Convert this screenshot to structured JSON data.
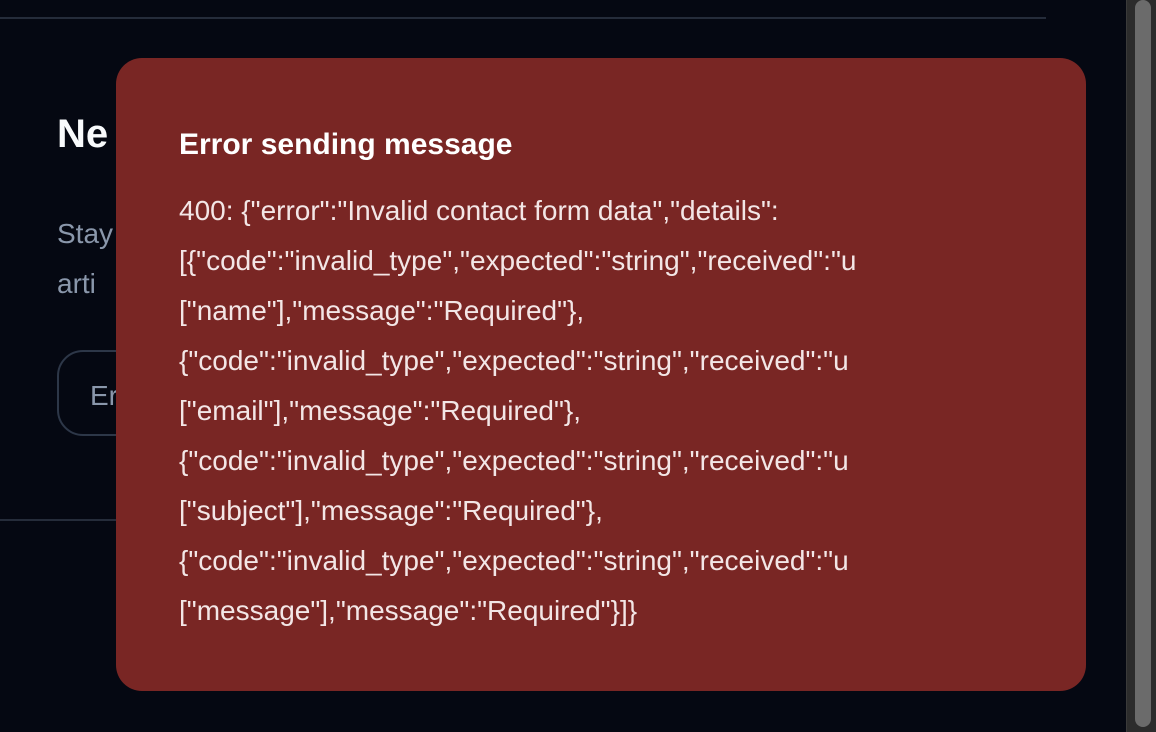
{
  "background": {
    "heading": "Ne",
    "subtitle_lines": [
      "Stay",
      "arti"
    ],
    "input_placeholder": "Er"
  },
  "toast": {
    "title": "Error sending message",
    "lines": [
      "400: {\"error\":\"Invalid contact form data\",\"details\":",
      "[{\"code\":\"invalid_type\",\"expected\":\"string\",\"received\":\"u",
      "[\"name\"],\"message\":\"Required\"},",
      "{\"code\":\"invalid_type\",\"expected\":\"string\",\"received\":\"u",
      "[\"email\"],\"message\":\"Required\"},",
      "{\"code\":\"invalid_type\",\"expected\":\"string\",\"received\":\"u",
      "[\"subject\"],\"message\":\"Required\"},",
      "{\"code\":\"invalid_type\",\"expected\":\"string\",\"received\":\"u",
      "[\"message\"],\"message\":\"Required\"}]}"
    ],
    "color": "#792624"
  }
}
